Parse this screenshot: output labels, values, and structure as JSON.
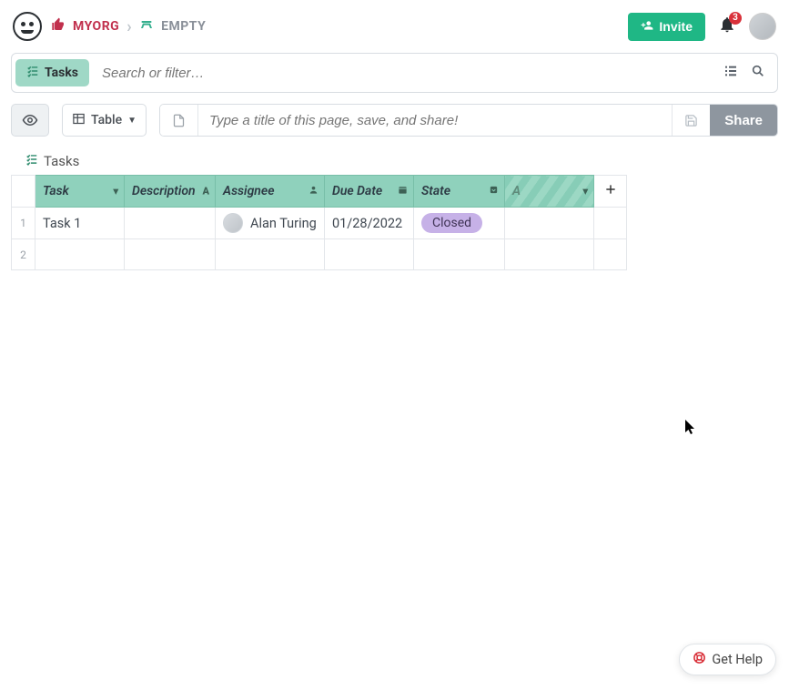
{
  "header": {
    "org": "MYORG",
    "page": "EMPTY",
    "invite_label": "Invite",
    "notification_count": "3"
  },
  "searchbar": {
    "chip_label": "Tasks",
    "placeholder": "Search or filter…"
  },
  "toolbar": {
    "view_label": "Table",
    "title_placeholder": "Type a title of this page, save, and share!",
    "share_label": "Share"
  },
  "grid": {
    "title": "Tasks",
    "columns": {
      "task": "Task",
      "description": "Description",
      "assignee": "Assignee",
      "due_date": "Due Date",
      "state": "State",
      "new": "A"
    },
    "rows": [
      {
        "num": "1",
        "task": "Task 1",
        "description": "",
        "assignee": "Alan Turing",
        "due_date": "01/28/2022",
        "state": "Closed"
      },
      {
        "num": "2",
        "task": "",
        "description": "",
        "assignee": "",
        "due_date": "",
        "state": ""
      }
    ]
  },
  "help": {
    "label": "Get Help"
  }
}
